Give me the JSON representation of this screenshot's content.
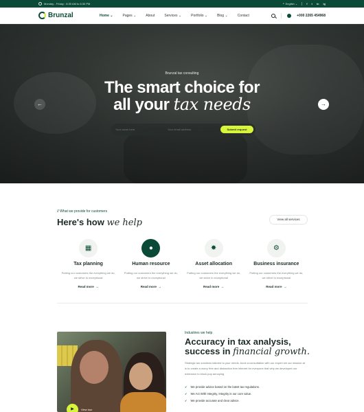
{
  "topbar": {
    "hours": "Monday - Friday : 8:30 AM to 6:30 PM",
    "language": "English",
    "social": [
      "f",
      "t",
      "in",
      "ig"
    ]
  },
  "header": {
    "logo": "Brunzal",
    "nav": [
      {
        "label": "Home"
      },
      {
        "label": "Pages"
      },
      {
        "label": "About"
      },
      {
        "label": "Services"
      },
      {
        "label": "Portfolio"
      },
      {
        "label": "Blog"
      },
      {
        "label": "Contact"
      }
    ],
    "phone": "+000 2265 454968"
  },
  "hero": {
    "tagline": "Brunzal tax consulting",
    "title_line1": "The smart choice for",
    "title_line2_plain": "all your ",
    "title_line2_em": "tax needs",
    "name_placeholder": "Your name here",
    "email_placeholder": "Your email address",
    "submit": "Submit request"
  },
  "services": {
    "eyebrow": "// What we provide for customers",
    "title_plain": "Here's how ",
    "title_em": "we help",
    "view_all": "View all services",
    "items": [
      {
        "title": "Tax planning",
        "desc": "Putting our customers the everything we do, we strive to exceptional",
        "more": "Read more",
        "icon": "calculator-icon"
      },
      {
        "title": "Human resource",
        "desc": "Putting our customers the everything we do, we strive to exceptional",
        "more": "Read more",
        "icon": "people-icon"
      },
      {
        "title": "Asset allocation",
        "desc": "Putting our customers the everything we do, we strive to exceptional",
        "more": "Read more",
        "icon": "lightbulb-icon"
      },
      {
        "title": "Business insurance",
        "desc": "Putting our customers the everything we do, we strive to exceptional",
        "more": "Read more",
        "icon": "gear-icon"
      }
    ]
  },
  "industries": {
    "eyebrow": "Industries we help",
    "title_line1": "Accuracy in tax analysis,",
    "title_line2_plain": "success in ",
    "title_line2_em": "financial growth.",
    "desc": "Strategic tax solutions tailored to your needs. book a consultation with our expert we our mission at is to create a worry free and distraction free internet for everyone that why we developed our extension to block pop annoying",
    "checks": [
      "We provide advice based on the latest tax regulations.",
      "We Act With Integrity, Integrity is our core value.",
      "We provide accurate and clear advice."
    ],
    "video_label": "View tour"
  },
  "colors": {
    "brand_green": "#0b4a36",
    "accent_lime": "#d9f53b"
  }
}
